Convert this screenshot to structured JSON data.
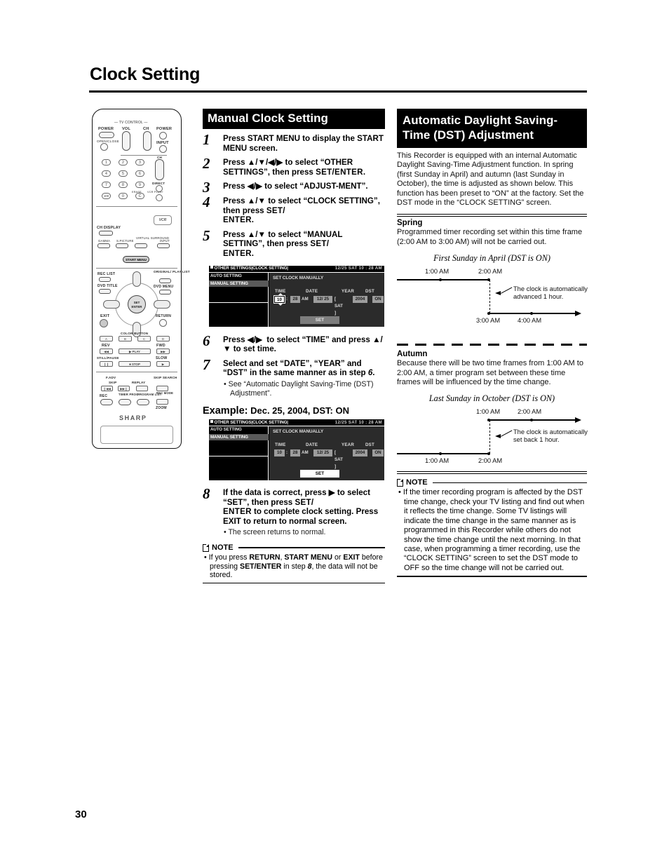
{
  "page": {
    "title": "Clock Setting",
    "number": "30"
  },
  "remote": {
    "tv_control_label": "— TV CONTROL —",
    "top_labels": [
      "POWER",
      "VOL",
      "CH",
      "POWER"
    ],
    "open_close": "OPEN/CLOSE",
    "input": "INPUT",
    "ch_right": "CH",
    "direct": "DIRECT",
    "erase": "ERASE",
    "vcr_plus": "VCR PLUS+",
    "numbers": [
      "1",
      "2",
      "3",
      "4",
      "5",
      "6",
      "7",
      "8",
      "9",
      "100",
      "0",
      "C"
    ],
    "ch_display": "CH DISPLAY",
    "gamma": "GAMMA",
    "s_picture": "S.PICTURE",
    "virtual_surround": "VIRTUAL SURROUND",
    "input2": "INPUT",
    "vcr_logo": "VCR",
    "vcr_logo_sup": "plus+",
    "start_menu": "START MENU",
    "rec_list": "REC LIST",
    "dvd_title": "DVD TITLE",
    "original_playlist": "ORIGINAL/ PLAY LIST",
    "dvd_menu": "DVD MENU",
    "set_enter": "SET/ ENTER",
    "exit": "EXIT",
    "return": "RETURN",
    "color_button": "COLOR BUTTON",
    "color_btns": [
      "A",
      "B",
      "C",
      "D"
    ],
    "rev": "REV",
    "fwd": "FWD",
    "play": "PLAY",
    "still_pause": "STILL/PAUSE",
    "slow": "SLOW",
    "stop": "STOP",
    "fadv": "F.ADV",
    "skip": "SKIP",
    "replay": "REPLAY",
    "skip_search": "SKIP SEARCH",
    "rec": "REC",
    "timer_prog": "TIMER PROG.",
    "program_list": "PROGRAM LIST",
    "rec_mode": "REC MODE",
    "zoom": "ZOOM",
    "brand": "SHARP"
  },
  "manual": {
    "heading": "Manual Clock Setting",
    "steps": [
      {
        "num": "1",
        "text": "Press START MENU to display the START MENU screen."
      },
      {
        "num": "2",
        "text": "Press ▲/▼/◀/▶ to select “OTHER SETTINGS”, then press SET/ENTER."
      },
      {
        "num": "3",
        "text": "Press ◀/▶ to select “ADJUST-MENT”."
      },
      {
        "num": "4",
        "text": "Press ▲/▼ to select “CLOCK SETTING”, then press SET/ENTER."
      },
      {
        "num": "5",
        "text": "Press ▲/▼ to select “MANUAL SETTING”, then press SET/ENTER."
      },
      {
        "num": "6",
        "text": "Press ◀/▶ to select “TIME” and press ▲/▼ to set time."
      },
      {
        "num": "7",
        "text": "Select and set “DATE”, “YEAR” and “DST” in the same manner as in step 6."
      },
      {
        "num": "8",
        "text": "If the data is correct, press ▶ to select “SET”, then press SET/ENTER to complete clock setting. Press EXIT to return to normal screen."
      }
    ],
    "step7_bullet": "• See “Automatic Daylight Saving-Time (DST) Adjustment”.",
    "step8_bullet": "• The screen returns to normal.",
    "example_label": "Example:",
    "example_value": " Dec. 25, 2004, DST: ON",
    "note_label": "NOTE",
    "note_text": "• If you press RETURN, START MENU or EXIT before pressing SET/ENTER in step 8, the data will not be stored."
  },
  "osd": {
    "title_left": "OTHER SETTINGS|CLOCK SETTING|",
    "title_right": "12/25  SAT  10 : 28  AM",
    "menu_items": [
      "AUTO SETTING",
      "MANUAL SETTING"
    ],
    "selected_menu": "MANUAL SETTING",
    "pane_heading": "SET CLOCK MANUALLY",
    "col_labels": [
      "TIME",
      "DATE",
      "YEAR",
      "DST"
    ],
    "hour": "10",
    "colon": ":",
    "minute": "28",
    "ampm": "AM",
    "date": "12/ 25",
    "weekday": "[ SAT ]",
    "year": "2004",
    "dst": "ON",
    "set_button": "SET"
  },
  "dst": {
    "heading": "Automatic Daylight Saving-Time (DST) Adjustment",
    "intro": "This Recorder is equipped with an internal Automatic Daylight Saving-Time Adjustment function. In spring (first Sunday in April) and autumn (last Sunday in October), the time is adjusted as shown below. This function has been preset to “ON” at the factory. Set the DST mode in the “CLOCK SETTING” screen.",
    "spring_heading": "Spring",
    "spring_text": "Programmed timer recording set within this time frame (2:00 AM to 3:00 AM) will not be carried out.",
    "spring_diagram_title": "First Sunday in April (DST is ON)",
    "spring_labels": {
      "top_left": "1:00 AM",
      "top_right": "2:00 AM",
      "bottom_left": "3:00 AM",
      "bottom_right": "4:00 AM"
    },
    "spring_annotation": "The clock is automatically advanced 1 hour.",
    "autumn_heading": "Autumn",
    "autumn_text": "Because there will be two time frames from 1:00 AM to 2:00 AM, a timer program set between these time frames will be influenced by the time change.",
    "autumn_diagram_title": "Last Sunday in October (DST is ON)",
    "autumn_labels": {
      "top_left": "1:00 AM",
      "top_right": "2:00 AM",
      "bottom_left": "1:00 AM",
      "bottom_right": "2:00 AM"
    },
    "autumn_annotation": "The clock is automatically set back 1 hour.",
    "note_label": "NOTE",
    "note_text": "• If the timer recording program is affected by the DST time change, check your TV listing and find out when it reflects the time change. Some TV listings will indicate the time change in the same manner as is programmed in this Recorder while others do not show the time change until the next morning. In that case, when programming a timer recording, use the “CLOCK SETTING” screen to set the DST mode to OFF so the time change will not be carried out."
  }
}
